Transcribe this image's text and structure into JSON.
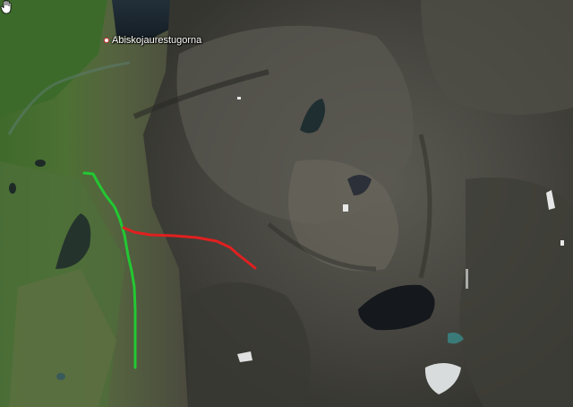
{
  "map": {
    "placemark": {
      "label": "Abiskojaurestugorna",
      "icon": "placemark-pin-icon"
    },
    "routes": [
      {
        "name": "green-route",
        "color": "#22c832"
      },
      {
        "name": "red-route",
        "color": "#e02020"
      }
    ],
    "cursor": {
      "icon": "hand-cursor-icon"
    }
  }
}
